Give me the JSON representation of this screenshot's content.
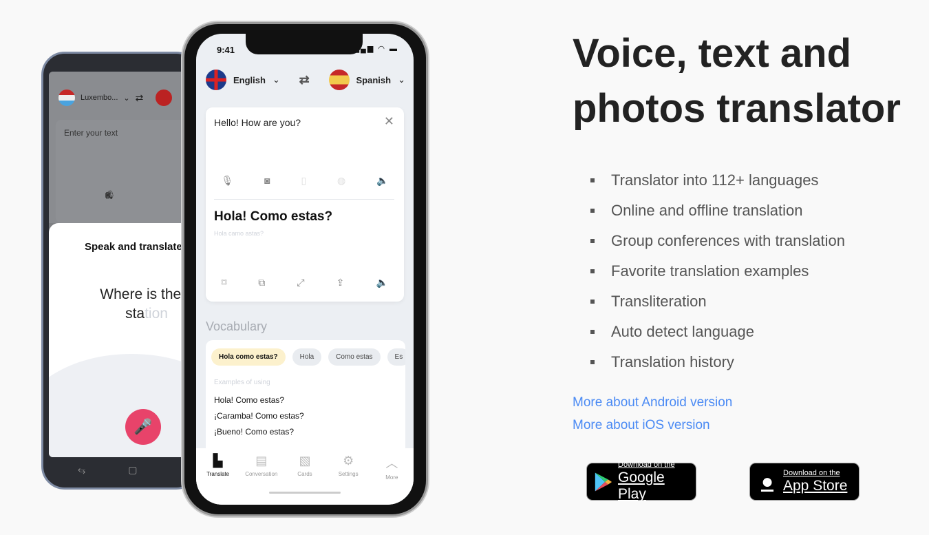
{
  "android": {
    "source_lang": "Luxembo...",
    "input_placeholder": "Enter your text",
    "sheet_title": "Speak and translate",
    "spoken": "Where is the b",
    "spoken2_done": "sta",
    "spoken2_pending": "tion"
  },
  "iphone": {
    "time": "9:41",
    "source_lang": "English",
    "target_lang": "Spanish",
    "input_text": "Hello! How are you?",
    "translation": "Hola! Como estas?",
    "transliteration": "Hola camo astas?",
    "vocab_title": "Vocabulary",
    "chips": [
      "Hola como estas?",
      "Hola",
      "Como estas",
      "Es"
    ],
    "examples_label": "Examples of using",
    "examples": [
      "Hola! Como estas?",
      "¡Caramba! Como estas?",
      "¡Bueno! Como estas?"
    ],
    "tabs": [
      {
        "label": "Translate",
        "icon": "translate-icon"
      },
      {
        "label": "Conversation",
        "icon": "chat-icon"
      },
      {
        "label": "Cards",
        "icon": "cards-icon"
      },
      {
        "label": "Settings",
        "icon": "gear-icon"
      },
      {
        "label": "More",
        "icon": "chevron-up-icon"
      }
    ]
  },
  "hero": {
    "title_line1": "Voice, text and",
    "title_line2": "photos translator",
    "features": [
      "Translator into 112+ languages",
      "Online and offline translation",
      "Group conferences with translation",
      "Favorite translation examples",
      "Transliteration",
      "Auto detect language",
      "Translation history"
    ],
    "android_link": "More about Android version",
    "ios_link": "More about iOS version",
    "google_play": {
      "small": "Download on the",
      "large": "Google Play"
    },
    "app_store": {
      "small": "Download on the",
      "large": "App Store"
    }
  },
  "colors": {
    "link": "#4a8af4",
    "mic": "#e8436a",
    "chip_selected": "#fcf1cd"
  }
}
